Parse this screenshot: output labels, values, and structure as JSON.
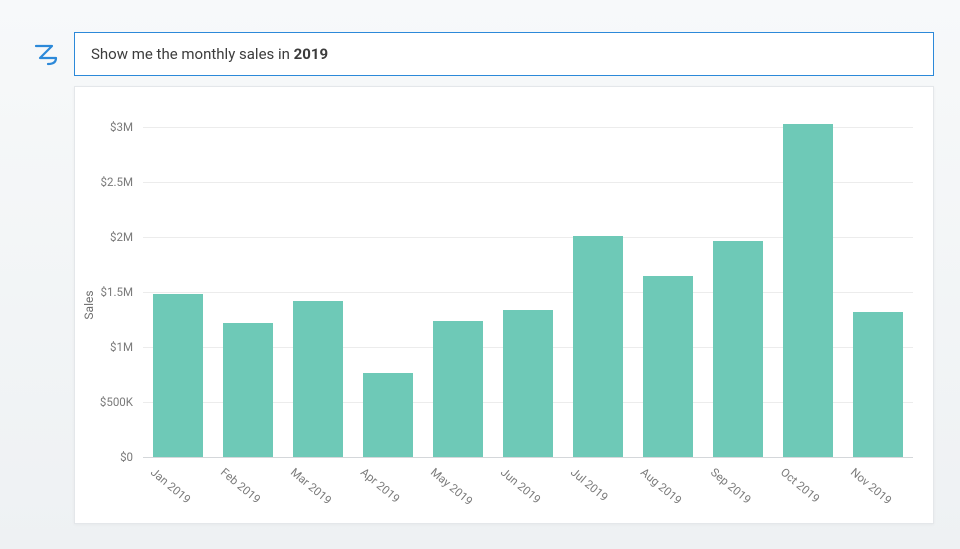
{
  "zia_icon_name": "zia-logo-icon",
  "query": {
    "prefix": "Show me the monthly sales in ",
    "bold": "2019"
  },
  "chart_data": {
    "type": "bar",
    "title": "",
    "xlabel": "",
    "ylabel": "Sales",
    "ylim": [
      0,
      3000000
    ],
    "y_ticks": [
      0,
      500000,
      1000000,
      1500000,
      2000000,
      2500000,
      3000000
    ],
    "y_tick_labels": [
      "$0",
      "$500K",
      "$1M",
      "$1.5M",
      "$2M",
      "$2.5M",
      "$3M"
    ],
    "categories": [
      "Jan 2019",
      "Feb 2019",
      "Mar 2019",
      "Apr 2019",
      "May 2019",
      "Jun 2019",
      "Jul 2019",
      "Aug 2019",
      "Sep 2019",
      "Oct 2019",
      "Nov 2019"
    ],
    "values": [
      1480000,
      1220000,
      1420000,
      760000,
      1240000,
      1340000,
      2010000,
      1650000,
      1960000,
      3030000,
      1320000
    ],
    "bar_color": "#6ec9b7"
  }
}
